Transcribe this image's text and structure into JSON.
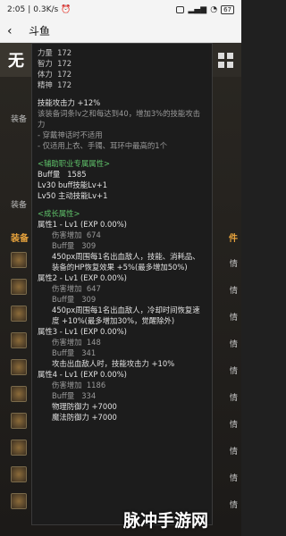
{
  "status_bar": {
    "time": "2:05",
    "speed": "0.3K/s",
    "battery": "67"
  },
  "app_bar": {
    "back_icon": "back-arrow-icon",
    "title": "斗鱼"
  },
  "game_bg": {
    "top_left_char": "无",
    "labels": [
      "装备",
      "装备",
      "装备"
    ],
    "right_labels": [
      "件",
      "情",
      "情",
      "情",
      "情",
      "情",
      "情",
      "情",
      "情",
      "情",
      "情"
    ],
    "right_header": "件"
  },
  "tooltip": {
    "stats": [
      {
        "name": "力量",
        "value": "172"
      },
      {
        "name": "智力",
        "value": "172"
      },
      {
        "name": "体力",
        "value": "172"
      },
      {
        "name": "精神",
        "value": "172"
      }
    ],
    "skill_attack": "技能攻击力 +12%",
    "skill_desc": "该装备词条lv之和每达到40，增加3%的技能攻击力",
    "note1": "- 穿戴神话时不适用",
    "note2": "- 仅适用上衣、手镯、耳环中最高的1个",
    "support_header": "<辅助职业专属属性>",
    "buff_line": {
      "name": "Buff量",
      "value": "1585"
    },
    "lv30": "Lv30 buff技能Lv+1",
    "lv50": "Lv50 主动技能Lv+1",
    "growth_header": "<成长属性>",
    "attrs": [
      {
        "title": "属性1 - Lv1 (EXP 0.00%)",
        "dmg": {
          "name": "伤害增加",
          "value": "674"
        },
        "buff": {
          "name": "Buff量",
          "value": "309"
        },
        "effect": "450px周围每1名出血敌人，技能、消耗品、装备的HP恢复效果 +5%(最多增加50%)"
      },
      {
        "title": "属性2 - Lv1 (EXP 0.00%)",
        "dmg": {
          "name": "伤害增加",
          "value": "647"
        },
        "buff": {
          "name": "Buff量",
          "value": "309"
        },
        "effect": "450px周围每1名出血敌人，冷却时间恢复速度 +10%(最多增加30%，觉醒除外)"
      },
      {
        "title": "属性3 - Lv1 (EXP 0.00%)",
        "dmg": {
          "name": "伤害增加",
          "value": "148"
        },
        "buff": {
          "name": "Buff量",
          "value": "341"
        },
        "effect": "攻击出血敌人时，技能攻击力 +10%"
      },
      {
        "title": "属性4 - Lv1 (EXP 0.00%)",
        "dmg": {
          "name": "伤害增加",
          "value": "1186"
        },
        "buff": {
          "name": "Buff量",
          "value": "334"
        },
        "effect": "物理防御力 +7000",
        "effect2": "魔法防御力 +7000"
      }
    ]
  },
  "watermark": "脉冲手游网"
}
